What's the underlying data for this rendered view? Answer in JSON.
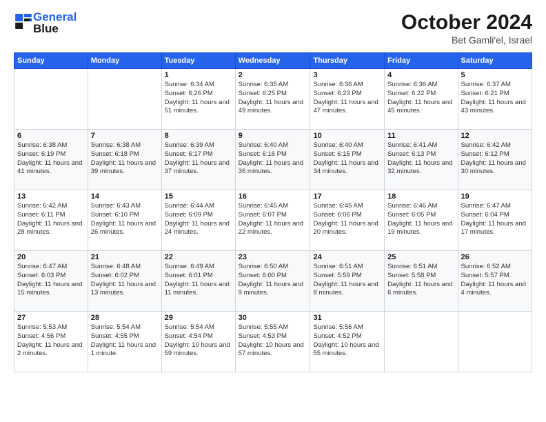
{
  "header": {
    "logo_general": "General",
    "logo_blue": "Blue",
    "month_title": "October 2024",
    "location": "Bet Gamli'el, Israel"
  },
  "columns": [
    "Sunday",
    "Monday",
    "Tuesday",
    "Wednesday",
    "Thursday",
    "Friday",
    "Saturday"
  ],
  "weeks": [
    [
      {
        "day": "",
        "info": ""
      },
      {
        "day": "",
        "info": ""
      },
      {
        "day": "1",
        "info": "Sunrise: 6:34 AM\nSunset: 6:26 PM\nDaylight: 11 hours and 51 minutes."
      },
      {
        "day": "2",
        "info": "Sunrise: 6:35 AM\nSunset: 6:25 PM\nDaylight: 11 hours and 49 minutes."
      },
      {
        "day": "3",
        "info": "Sunrise: 6:36 AM\nSunset: 6:23 PM\nDaylight: 11 hours and 47 minutes."
      },
      {
        "day": "4",
        "info": "Sunrise: 6:36 AM\nSunset: 6:22 PM\nDaylight: 11 hours and 45 minutes."
      },
      {
        "day": "5",
        "info": "Sunrise: 6:37 AM\nSunset: 6:21 PM\nDaylight: 11 hours and 43 minutes."
      }
    ],
    [
      {
        "day": "6",
        "info": "Sunrise: 6:38 AM\nSunset: 6:19 PM\nDaylight: 11 hours and 41 minutes."
      },
      {
        "day": "7",
        "info": "Sunrise: 6:38 AM\nSunset: 6:18 PM\nDaylight: 11 hours and 39 minutes."
      },
      {
        "day": "8",
        "info": "Sunrise: 6:39 AM\nSunset: 6:17 PM\nDaylight: 11 hours and 37 minutes."
      },
      {
        "day": "9",
        "info": "Sunrise: 6:40 AM\nSunset: 6:16 PM\nDaylight: 11 hours and 36 minutes."
      },
      {
        "day": "10",
        "info": "Sunrise: 6:40 AM\nSunset: 6:15 PM\nDaylight: 11 hours and 34 minutes."
      },
      {
        "day": "11",
        "info": "Sunrise: 6:41 AM\nSunset: 6:13 PM\nDaylight: 11 hours and 32 minutes."
      },
      {
        "day": "12",
        "info": "Sunrise: 6:42 AM\nSunset: 6:12 PM\nDaylight: 11 hours and 30 minutes."
      }
    ],
    [
      {
        "day": "13",
        "info": "Sunrise: 6:42 AM\nSunset: 6:11 PM\nDaylight: 11 hours and 28 minutes."
      },
      {
        "day": "14",
        "info": "Sunrise: 6:43 AM\nSunset: 6:10 PM\nDaylight: 11 hours and 26 minutes."
      },
      {
        "day": "15",
        "info": "Sunrise: 6:44 AM\nSunset: 6:09 PM\nDaylight: 11 hours and 24 minutes."
      },
      {
        "day": "16",
        "info": "Sunrise: 6:45 AM\nSunset: 6:07 PM\nDaylight: 11 hours and 22 minutes."
      },
      {
        "day": "17",
        "info": "Sunrise: 6:45 AM\nSunset: 6:06 PM\nDaylight: 11 hours and 20 minutes."
      },
      {
        "day": "18",
        "info": "Sunrise: 6:46 AM\nSunset: 6:05 PM\nDaylight: 11 hours and 19 minutes."
      },
      {
        "day": "19",
        "info": "Sunrise: 6:47 AM\nSunset: 6:04 PM\nDaylight: 11 hours and 17 minutes."
      }
    ],
    [
      {
        "day": "20",
        "info": "Sunrise: 6:47 AM\nSunset: 6:03 PM\nDaylight: 11 hours and 15 minutes."
      },
      {
        "day": "21",
        "info": "Sunrise: 6:48 AM\nSunset: 6:02 PM\nDaylight: 11 hours and 13 minutes."
      },
      {
        "day": "22",
        "info": "Sunrise: 6:49 AM\nSunset: 6:01 PM\nDaylight: 11 hours and 11 minutes."
      },
      {
        "day": "23",
        "info": "Sunrise: 6:50 AM\nSunset: 6:00 PM\nDaylight: 11 hours and 9 minutes."
      },
      {
        "day": "24",
        "info": "Sunrise: 6:51 AM\nSunset: 5:59 PM\nDaylight: 11 hours and 8 minutes."
      },
      {
        "day": "25",
        "info": "Sunrise: 6:51 AM\nSunset: 5:58 PM\nDaylight: 11 hours and 6 minutes."
      },
      {
        "day": "26",
        "info": "Sunrise: 6:52 AM\nSunset: 5:57 PM\nDaylight: 11 hours and 4 minutes."
      }
    ],
    [
      {
        "day": "27",
        "info": "Sunrise: 5:53 AM\nSunset: 4:56 PM\nDaylight: 11 hours and 2 minutes."
      },
      {
        "day": "28",
        "info": "Sunrise: 5:54 AM\nSunset: 4:55 PM\nDaylight: 11 hours and 1 minute."
      },
      {
        "day": "29",
        "info": "Sunrise: 5:54 AM\nSunset: 4:54 PM\nDaylight: 10 hours and 59 minutes."
      },
      {
        "day": "30",
        "info": "Sunrise: 5:55 AM\nSunset: 4:53 PM\nDaylight: 10 hours and 57 minutes."
      },
      {
        "day": "31",
        "info": "Sunrise: 5:56 AM\nSunset: 4:52 PM\nDaylight: 10 hours and 55 minutes."
      },
      {
        "day": "",
        "info": ""
      },
      {
        "day": "",
        "info": ""
      }
    ]
  ]
}
